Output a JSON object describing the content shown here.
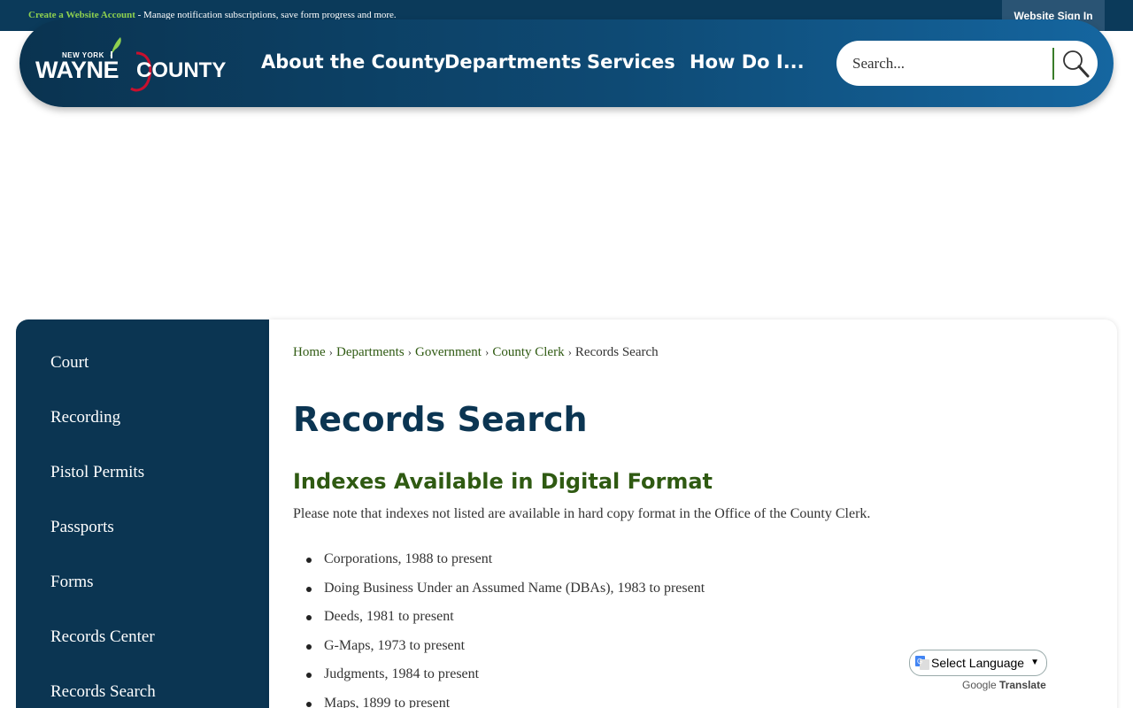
{
  "topbar": {
    "create_account_link": "Create a Website Account",
    "create_account_desc": " - Manage notification subscriptions, save form progress and more.",
    "signin_label": "Website Sign In"
  },
  "logo": {
    "state": "NEW YORK",
    "name_part1": "WAYNE",
    "name_part2": "COUNTY"
  },
  "nav": {
    "items": [
      {
        "label": "About the County"
      },
      {
        "label": "Departments"
      },
      {
        "label": "Services"
      },
      {
        "label": "How Do I..."
      }
    ]
  },
  "search": {
    "placeholder": "Search...",
    "value": ""
  },
  "sidebar": {
    "items": [
      {
        "label": "Court"
      },
      {
        "label": "Recording"
      },
      {
        "label": "Pistol Permits"
      },
      {
        "label": "Passports"
      },
      {
        "label": "Forms"
      },
      {
        "label": "Records Center"
      },
      {
        "label": "Records Search"
      }
    ]
  },
  "breadcrumb": {
    "items": [
      {
        "label": "Home"
      },
      {
        "label": "Departments"
      },
      {
        "label": "Government"
      },
      {
        "label": "County Clerk"
      }
    ],
    "current": "Records Search",
    "separator": "›"
  },
  "main": {
    "title": "Records Search",
    "section_heading": "Indexes Available in Digital Format",
    "intro": "Please note that indexes not listed are available in hard copy format in the Office of the County Clerk.",
    "list": [
      "Corporations, 1988 to present",
      "Doing Business Under an Assumed Name (DBAs), 1983 to present",
      "Deeds, 1981 to present",
      "G-Maps, 1973 to present",
      "Judgments, 1984 to present",
      "Maps, 1899 to present"
    ]
  },
  "translate": {
    "select_label": "Select Language",
    "powered_google": "Google",
    "powered_translate": "Translate"
  },
  "colors": {
    "navy": "#0b3552",
    "green": "#2f5a12",
    "accent_green": "#8fd14f"
  }
}
